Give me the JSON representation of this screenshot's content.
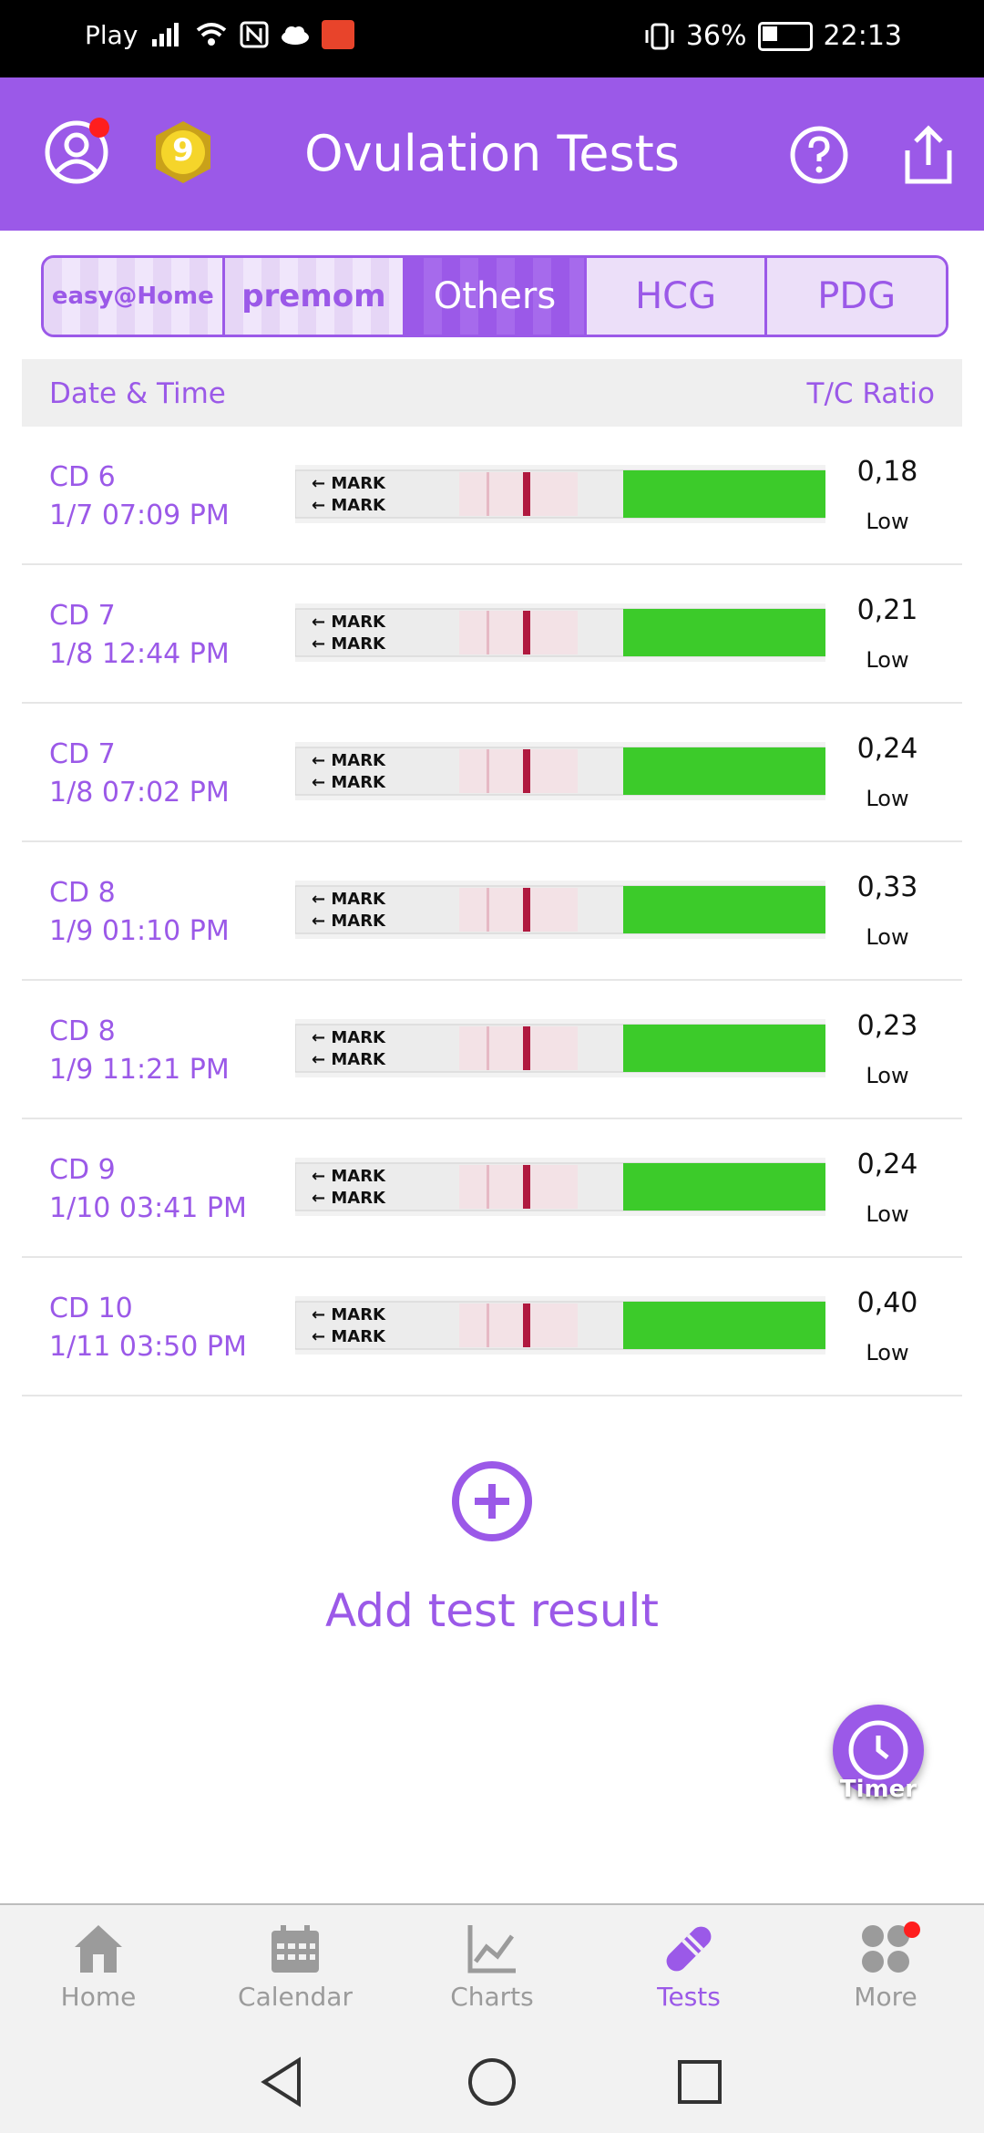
{
  "status_bar": {
    "carrier": "Play",
    "battery": "36%",
    "time": "22:13"
  },
  "header": {
    "title": "Ovulation Tests",
    "badge_level": "9"
  },
  "brand_tabs": [
    {
      "label": "easy@Home",
      "active": false
    },
    {
      "label": "premom",
      "active": false
    },
    {
      "label": "Others",
      "active": true
    },
    {
      "label": "HCG",
      "active": false
    },
    {
      "label": "PDG",
      "active": false
    }
  ],
  "table": {
    "col_left": "Date & Time",
    "col_right": "T/C Ratio",
    "rows": [
      {
        "cd": "CD 6",
        "datetime": "1/7  07:09 PM",
        "ratio": "0,18",
        "level": "Low"
      },
      {
        "cd": "CD 7",
        "datetime": "1/8  12:44 PM",
        "ratio": "0,21",
        "level": "Low"
      },
      {
        "cd": "CD 7",
        "datetime": "1/8  07:02 PM",
        "ratio": "0,24",
        "level": "Low"
      },
      {
        "cd": "CD 8",
        "datetime": "1/9  01:10 PM",
        "ratio": "0,33",
        "level": "Low"
      },
      {
        "cd": "CD 8",
        "datetime": "1/9  11:21 PM",
        "ratio": "0,23",
        "level": "Low"
      },
      {
        "cd": "CD 9",
        "datetime": "1/10  03:41 PM",
        "ratio": "0,24",
        "level": "Low"
      },
      {
        "cd": "CD 10",
        "datetime": "1/11  03:50 PM",
        "ratio": "0,40",
        "level": "Low"
      }
    ]
  },
  "add": {
    "label": "Add test result"
  },
  "timer": {
    "label": "Timer"
  },
  "bottom_nav": [
    {
      "label": "Home",
      "icon": "home-icon",
      "active": false
    },
    {
      "label": "Calendar",
      "icon": "calendar-icon",
      "active": false
    },
    {
      "label": "Charts",
      "icon": "charts-icon",
      "active": false
    },
    {
      "label": "Tests",
      "icon": "tests-icon",
      "active": true
    },
    {
      "label": "More",
      "icon": "more-icon",
      "active": false
    }
  ],
  "colors": {
    "accent": "#9b59e8",
    "strip_green": "#3ccb2a",
    "test_line": "#b0193f"
  },
  "strip_label": "MARK"
}
